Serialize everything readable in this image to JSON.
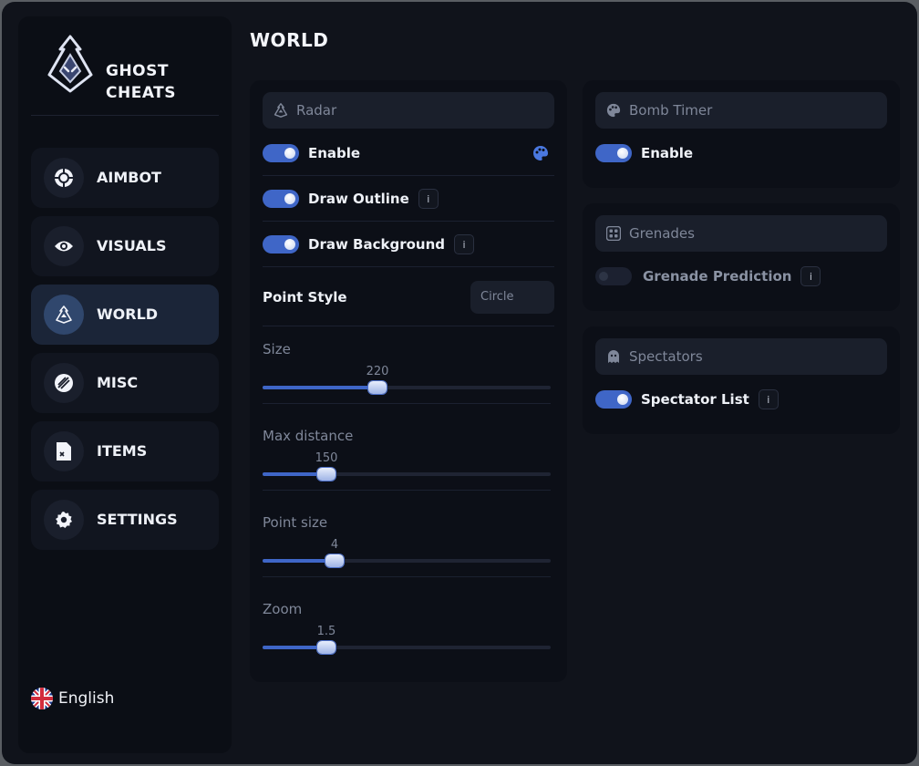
{
  "brand": {
    "line1": "GHOST",
    "line2": "CHEATS"
  },
  "page_title": "WORLD",
  "nav": {
    "items": [
      {
        "label": "AIMBOT",
        "icon": "crosshair-icon"
      },
      {
        "label": "VISUALS",
        "icon": "eye-icon"
      },
      {
        "label": "WORLD",
        "icon": "world-icon",
        "active": true
      },
      {
        "label": "MISC",
        "icon": "misc-icon"
      },
      {
        "label": "ITEMS",
        "icon": "file-icon"
      },
      {
        "label": "SETTINGS",
        "icon": "gear-icon"
      }
    ]
  },
  "language": {
    "label": "English",
    "icon": "uk-flag-icon"
  },
  "radar": {
    "title": "Radar",
    "enable": {
      "label": "Enable",
      "on": true
    },
    "draw_outline": {
      "label": "Draw Outline",
      "on": true,
      "info": "i"
    },
    "draw_background": {
      "label": "Draw Background",
      "on": true,
      "info": "i"
    },
    "point_style": {
      "label": "Point Style",
      "value": "Circle"
    },
    "size": {
      "label": "Size",
      "value": "220",
      "fraction": 0.4
    },
    "max_distance": {
      "label": "Max distance",
      "value": "150",
      "fraction": 0.222
    },
    "point_size": {
      "label": "Point size",
      "value": "4",
      "fraction": 0.25
    },
    "zoom": {
      "label": "Zoom",
      "value": "1.5",
      "fraction": 0.222
    }
  },
  "bomb_timer": {
    "title": "Bomb Timer",
    "enable": {
      "label": "Enable",
      "on": true
    }
  },
  "grenades": {
    "title": "Grenades",
    "prediction": {
      "label": "Grenade Prediction",
      "on": false,
      "info": "i"
    }
  },
  "spectators": {
    "title": "Spectators",
    "list": {
      "label": "Spectator List",
      "on": true,
      "info": "i"
    }
  },
  "colors": {
    "accent": "#3f66c7",
    "background": "#10131b",
    "panel": "#0c0f17",
    "active_nav": "#1b2538"
  }
}
